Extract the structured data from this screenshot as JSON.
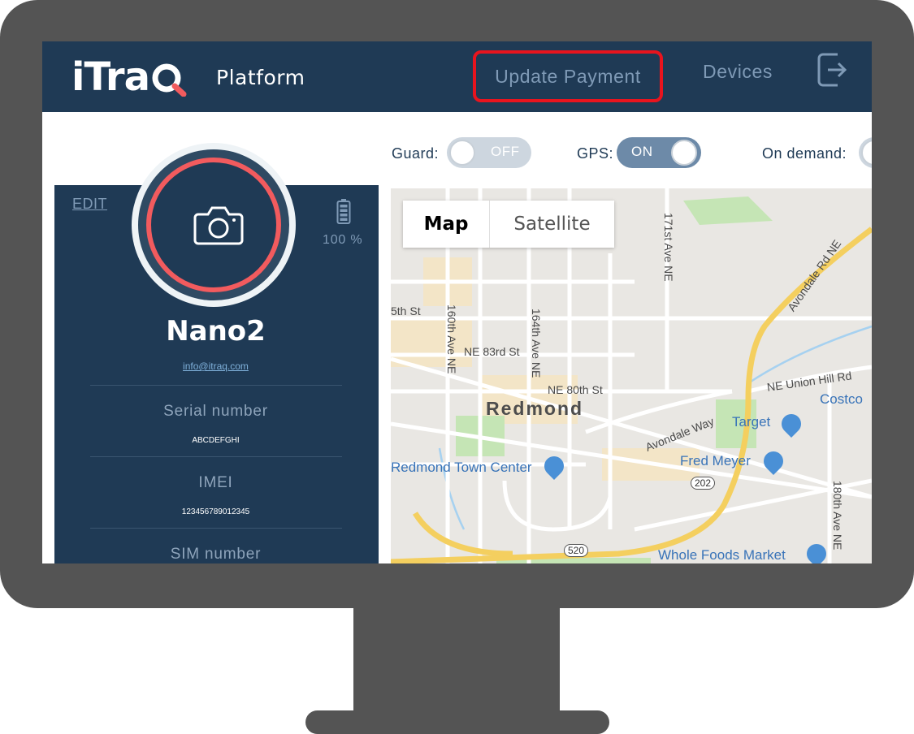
{
  "header": {
    "logo_word": "iTra",
    "logo_sub": "Platform",
    "nav": {
      "update_payment": "Update Payment",
      "devices": "Devices"
    }
  },
  "toggles": {
    "guard": {
      "label": "Guard:",
      "state": "OFF"
    },
    "gps": {
      "label": "GPS:",
      "state": "ON"
    },
    "on_demand": {
      "label": "On demand:"
    }
  },
  "device": {
    "edit": "EDIT",
    "battery": "100 %",
    "name": "Nano2",
    "email": "info@itraq.com",
    "serial_label": "Serial number",
    "serial_value": "ABCDEFGHI",
    "imei_label": "IMEI",
    "imei_value": "123456789012345",
    "sim_label": "SIM number"
  },
  "map": {
    "type_map": "Map",
    "type_satellite": "Satellite",
    "city": "Redmond",
    "labels": {
      "ave171": "171st Ave NE",
      "avondale_rd": "Avondale Rd NE",
      "st5": "5th St",
      "ave160": "160th Ave NE",
      "ave164": "164th Ave NE",
      "ne83": "NE 83rd St",
      "ne80": "NE 80th St",
      "union_hill": "NE Union Hill Rd",
      "avondale_way": "Avondale Way",
      "ave180": "180th Ave NE"
    },
    "pois": {
      "costco": "Costco",
      "target": "Target",
      "fred_meyer": "Fred Meyer",
      "town_center": "Redmond Town Center",
      "whole_foods": "Whole Foods Market"
    },
    "shields": {
      "r202": "202",
      "r520": "520"
    }
  },
  "colors": {
    "header_bg": "#1f3a55",
    "accent_red": "#e8141e",
    "ring_coral": "#f25b5e",
    "nav_text": "#7f9ab6"
  }
}
